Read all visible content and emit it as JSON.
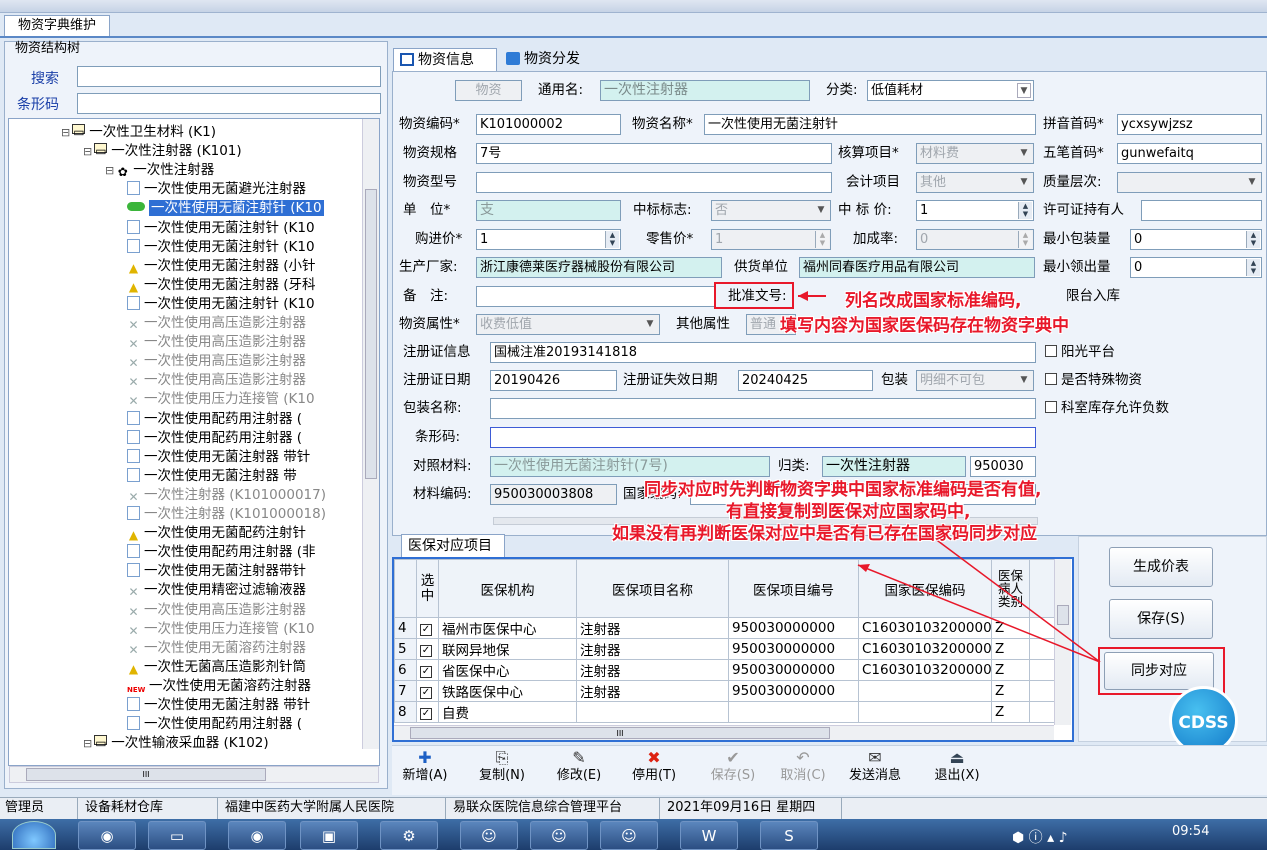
{
  "window": {
    "doc_tab": "物资字典维护"
  },
  "left": {
    "group_title": "物资结构树",
    "search_label": "搜索",
    "barcode_label": "条形码",
    "tree": [
      {
        "text": "一次性卫生材料 (K1)",
        "icon": "folder-icon",
        "indent": 1,
        "style": "n"
      },
      {
        "text": "一次性注射器 (K101)",
        "icon": "folder-icon",
        "indent": 2,
        "style": "n"
      },
      {
        "text": "一次性注射器",
        "icon": "category-icon",
        "indent": 3,
        "style": "n"
      },
      {
        "text": "一次性使用无菌避光注射器",
        "icon": "doc-icon",
        "indent": 4,
        "style": "n"
      },
      {
        "text": "一次性使用无菌注射针 (K10",
        "icon": "pill-icon",
        "indent": 4,
        "style": "sel"
      },
      {
        "text": "一次性使用无菌注射针 (K10",
        "icon": "doc-icon",
        "indent": 4,
        "style": "n"
      },
      {
        "text": "一次性使用无菌注射针 (K10",
        "icon": "doc-icon",
        "indent": 4,
        "style": "n"
      },
      {
        "text": "一次性使用无菌注射器 (小针",
        "icon": "bell-icon",
        "indent": 4,
        "style": "n"
      },
      {
        "text": "一次性使用无菌注射器 (牙科",
        "icon": "bell-icon",
        "indent": 4,
        "style": "n"
      },
      {
        "text": "一次性使用无菌注射针 (K10",
        "icon": "doc-icon",
        "indent": 4,
        "style": "n"
      },
      {
        "text": "一次性使用高压造影注射器",
        "icon": "x-icon",
        "indent": 4,
        "style": "g"
      },
      {
        "text": "一次性使用高压造影注射器",
        "icon": "x-icon",
        "indent": 4,
        "style": "g"
      },
      {
        "text": "一次性使用高压造影注射器",
        "icon": "x-icon",
        "indent": 4,
        "style": "g"
      },
      {
        "text": "一次性使用高压造影注射器",
        "icon": "x-icon",
        "indent": 4,
        "style": "g"
      },
      {
        "text": "一次性使用压力连接管 (K10",
        "icon": "x-icon",
        "indent": 4,
        "style": "g"
      },
      {
        "text": "一次性使用配药用注射器 (",
        "icon": "doc-icon",
        "indent": 4,
        "style": "n"
      },
      {
        "text": "一次性使用配药用注射器 (",
        "icon": "doc-icon",
        "indent": 4,
        "style": "n"
      },
      {
        "text": "一次性使用无菌注射器 带针",
        "icon": "doc-icon",
        "indent": 4,
        "style": "n"
      },
      {
        "text": "一次性使用无菌注射器 带",
        "icon": "doc-icon",
        "indent": 4,
        "style": "n"
      },
      {
        "text": "一次性注射器 (K101000017)",
        "icon": "x-icon",
        "indent": 4,
        "style": "g"
      },
      {
        "text": "一次性注射器 (K101000018)",
        "icon": "doc-icon",
        "indent": 4,
        "style": "g"
      },
      {
        "text": "一次性使用无菌配药注射针",
        "icon": "bell-icon",
        "indent": 4,
        "style": "n"
      },
      {
        "text": "一次性使用配药用注射器 (非",
        "icon": "doc-icon",
        "indent": 4,
        "style": "n"
      },
      {
        "text": "一次性使用无菌注射器带针",
        "icon": "doc-icon",
        "indent": 4,
        "style": "n"
      },
      {
        "text": "一次性使用精密过滤输液器",
        "icon": "x-icon",
        "indent": 4,
        "style": "n"
      },
      {
        "text": "一次性使用高压造影注射器",
        "icon": "x-icon",
        "indent": 4,
        "style": "g"
      },
      {
        "text": "一次性使用压力连接管 (K10",
        "icon": "x-icon",
        "indent": 4,
        "style": "g"
      },
      {
        "text": "一次性使用无菌溶药注射器",
        "icon": "x-icon",
        "indent": 4,
        "style": "g"
      },
      {
        "text": "一次性无菌高压造影剂针筒",
        "icon": "bell-icon",
        "indent": 4,
        "style": "n"
      },
      {
        "text": "一次性使用无菌溶药注射器",
        "icon": "new-icon",
        "indent": 4,
        "style": "n"
      },
      {
        "text": "一次性使用无菌注射器 带针",
        "icon": "doc-icon",
        "indent": 4,
        "style": "n"
      },
      {
        "text": "一次性使用配药用注射器 (",
        "icon": "doc-icon",
        "indent": 4,
        "style": "n"
      },
      {
        "text": "一次性输液采血器 (K102)",
        "icon": "folder-icon",
        "indent": 2,
        "style": "n"
      }
    ],
    "hscroll_label": "III"
  },
  "tabs": {
    "info": "物资信息",
    "dist": "物资分发"
  },
  "form": {
    "wuzi": "物资",
    "common_name_label": "通用名:",
    "common_name": "一次性注射器",
    "category_label": "分类:",
    "category": "低值耗材",
    "code_label": "物资编码*",
    "code": "K101000002",
    "name_label": "物资名称*",
    "name": "一次性使用无菌注射针",
    "pinyin_label": "拼音首码*",
    "pinyin": "ycxsywjzsz",
    "spec_label": "物资规格",
    "spec": "7号",
    "acct_item_label": "核算项目*",
    "acct_item": "材料费",
    "wubi_label": "五笔首码*",
    "wubi": "gunwefaitq",
    "model_label": "物资型号",
    "fin_item_label": "会计项目",
    "fin_item": "其他",
    "quality_label": "质量层次:",
    "unit_label": "单　位*",
    "unit": "支",
    "bid_flag_label": "中标标志:",
    "bid_flag": "否",
    "bid_price_label": "中 标 价:",
    "bid_price": "1",
    "license_holder_label": "许可证持有人",
    "purchase_label": "购进价*",
    "purchase": "1",
    "retail_label": "零售价*",
    "retail": "1",
    "markup_label": "加成率:",
    "markup": "0",
    "min_pack_label": "最小包装量",
    "min_pack": "0",
    "maker_label": "生产厂家:",
    "maker": "浙江康德莱医疗器械股份有限公司",
    "supplier_label": "供货单位",
    "supplier": "福州同春医疗用品有限公司",
    "min_out_label": "最小领出量",
    "min_out": "0",
    "remark_label": "备　注:",
    "approval_label": "批准文号:",
    "bed_in": "限台入库",
    "attr_label": "物资属性*",
    "attr": "收费低值",
    "other_attr_label": "其他属性",
    "other_attr": "普通",
    "reg_info_label": "注册证信息",
    "reg_info": "国械注准20193141818",
    "yang": "阳光平台",
    "reg_date_label": "注册证日期",
    "reg_date": "20190426",
    "reg_exp_label": "注册证失效日期",
    "reg_exp": "20240425",
    "pack_label": "包装",
    "pack": "明细不可包",
    "special": "是否特殊物资",
    "pack_name_label": "包装名称:",
    "dept_neg": "科室库存允许负数",
    "barcode2_label": "条形码:",
    "ref_mat_label": "对照材料:",
    "ref_mat": "一次性使用无菌注射针(7号)",
    "belong_label": "归类:",
    "belong": "一次性注射器",
    "belong_code": "950030",
    "mat_code_label": "材料编码:",
    "mat_code": "950030003808",
    "nat_code_label": "国家编码:"
  },
  "yb": {
    "title": "医保对应项目",
    "headers": [
      "选中",
      "医保机构",
      "医保项目名称",
      "医保项目编号",
      "国家医保编码",
      "医保病人类别"
    ],
    "rows": [
      {
        "n": "4",
        "org": "福州市医保中心",
        "name": "注射器",
        "code": "950030000000",
        "nat": "C160301032000000",
        "type": "Z"
      },
      {
        "n": "5",
        "org": "联网异地保",
        "name": "注射器",
        "code": "950030000000",
        "nat": "C160301032000000",
        "type": "Z"
      },
      {
        "n": "6",
        "org": "省医保中心",
        "name": "注射器",
        "code": "950030000000",
        "nat": "C160301032000000",
        "type": "Z"
      },
      {
        "n": "7",
        "org": "铁路医保中心",
        "name": "注射器",
        "code": "950030000000",
        "nat": "",
        "type": "Z"
      },
      {
        "n": "8",
        "org": "自费",
        "name": "",
        "code": "",
        "nat": "",
        "type": "Z"
      }
    ],
    "hscroll": "III"
  },
  "buttons": {
    "gen_price": "生成价表",
    "save": "保存(S)",
    "sync": "同步对应",
    "cdss": "CDSS"
  },
  "toolbar": [
    {
      "icon": "plus-icon",
      "label": "新增(A)",
      "glyph": "✚",
      "color": "#1c5fc4",
      "dis": false
    },
    {
      "icon": "copy-icon",
      "label": "复制(N)",
      "glyph": "⎘",
      "color": "#333",
      "dis": false
    },
    {
      "icon": "edit-icon",
      "label": "修改(E)",
      "glyph": "✎",
      "color": "#333",
      "dis": false
    },
    {
      "icon": "stop-icon",
      "label": "停用(T)",
      "glyph": "✖",
      "color": "#d21",
      "dis": false
    },
    {
      "icon": "check-icon",
      "label": "保存(S)",
      "glyph": "✔",
      "color": "#999",
      "dis": true
    },
    {
      "icon": "undo-icon",
      "label": "取消(C)",
      "glyph": "↶",
      "color": "#999",
      "dis": true
    },
    {
      "icon": "message-icon",
      "label": "发送消息",
      "glyph": "✉",
      "color": "#333",
      "dis": false
    },
    {
      "icon": "exit-icon",
      "label": "退出(X)",
      "glyph": "⏏",
      "color": "#345",
      "dis": false
    }
  ],
  "status": [
    "管理员",
    "设备耗材仓库",
    "福建中医药大学附属人民医院",
    "易联众医院信息综合管理平台",
    "2021年09月16日 星期四"
  ],
  "annotations": {
    "a1": "列名改成国家标准编码,",
    "a2": "填写内容为国家医保码存在物资字典中",
    "a3": "同步对应时先判断物资字典中国家标准编码是否有值,",
    "a4": "有直接复制到医保对应国家码中,",
    "a5": "如果没有再判断医保对应中是否有已存在国家码同步对应"
  },
  "clock": "09:54",
  "colors": {
    "accent": "#2f6fd4",
    "annotation": "#e8182a"
  }
}
